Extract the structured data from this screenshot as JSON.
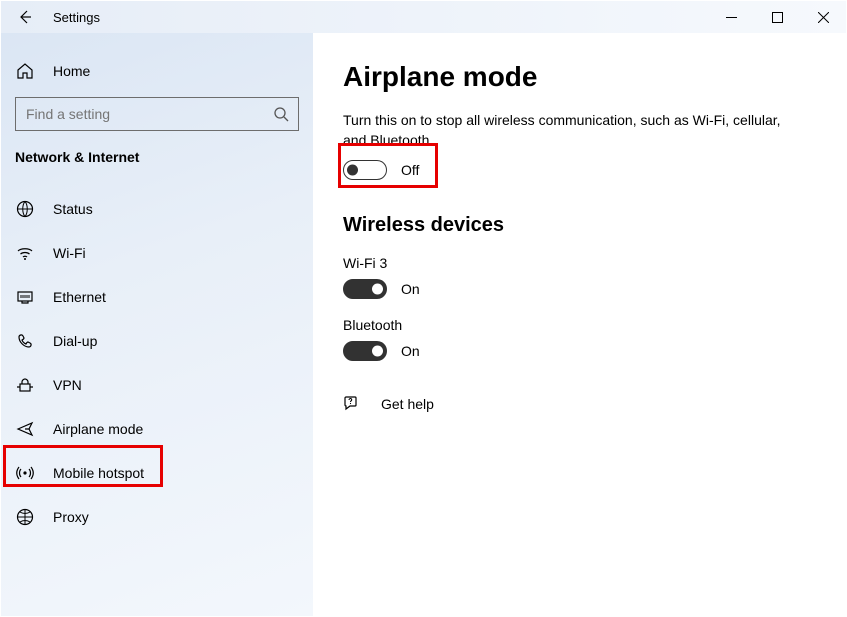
{
  "titlebar": {
    "title": "Settings"
  },
  "sidebar": {
    "home_label": "Home",
    "search_placeholder": "Find a setting",
    "section_heading": "Network & Internet",
    "items": [
      {
        "label": "Status"
      },
      {
        "label": "Wi-Fi"
      },
      {
        "label": "Ethernet"
      },
      {
        "label": "Dial-up"
      },
      {
        "label": "VPN"
      },
      {
        "label": "Airplane mode"
      },
      {
        "label": "Mobile hotspot"
      },
      {
        "label": "Proxy"
      }
    ]
  },
  "content": {
    "heading": "Airplane mode",
    "description": "Turn this on to stop all wireless communication, such as Wi-Fi, cellular, and Bluetooth",
    "airplane_toggle_state": "Off",
    "wireless_heading": "Wireless devices",
    "wifi_label": "Wi-Fi 3",
    "wifi_state": "On",
    "bluetooth_label": "Bluetooth",
    "bluetooth_state": "On",
    "help_label": "Get help"
  }
}
